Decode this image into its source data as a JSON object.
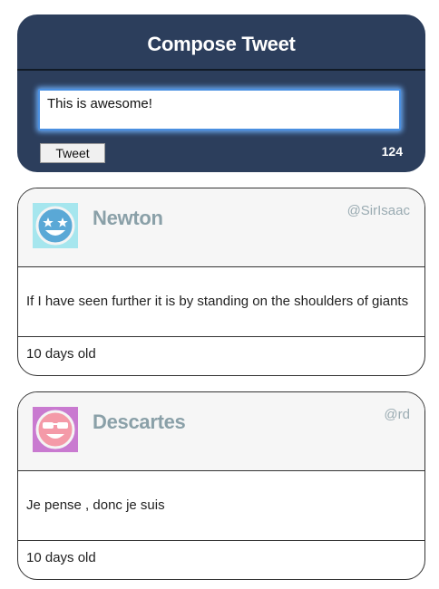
{
  "compose": {
    "title": "Compose Tweet",
    "input_value": "This is awesome!",
    "button_label": "Tweet",
    "char_count": "124"
  },
  "tweets": [
    {
      "name": "Newton",
      "handle": "@SirIsaac",
      "text": "If I have seen further it is by standing on the shoulders of giants",
      "age": "10 days old",
      "avatar_icon": "star-eyes-smiley-icon",
      "avatar_bg": "#a6e6ee",
      "avatar_fg": "#5aa8d6"
    },
    {
      "name": "Descartes",
      "handle": "@rd",
      "text": "Je pense , donc je suis",
      "age": "10 days old",
      "avatar_icon": "sunglasses-smiley-icon",
      "avatar_bg": "#c97ad0",
      "avatar_fg": "#f49aa8"
    }
  ]
}
